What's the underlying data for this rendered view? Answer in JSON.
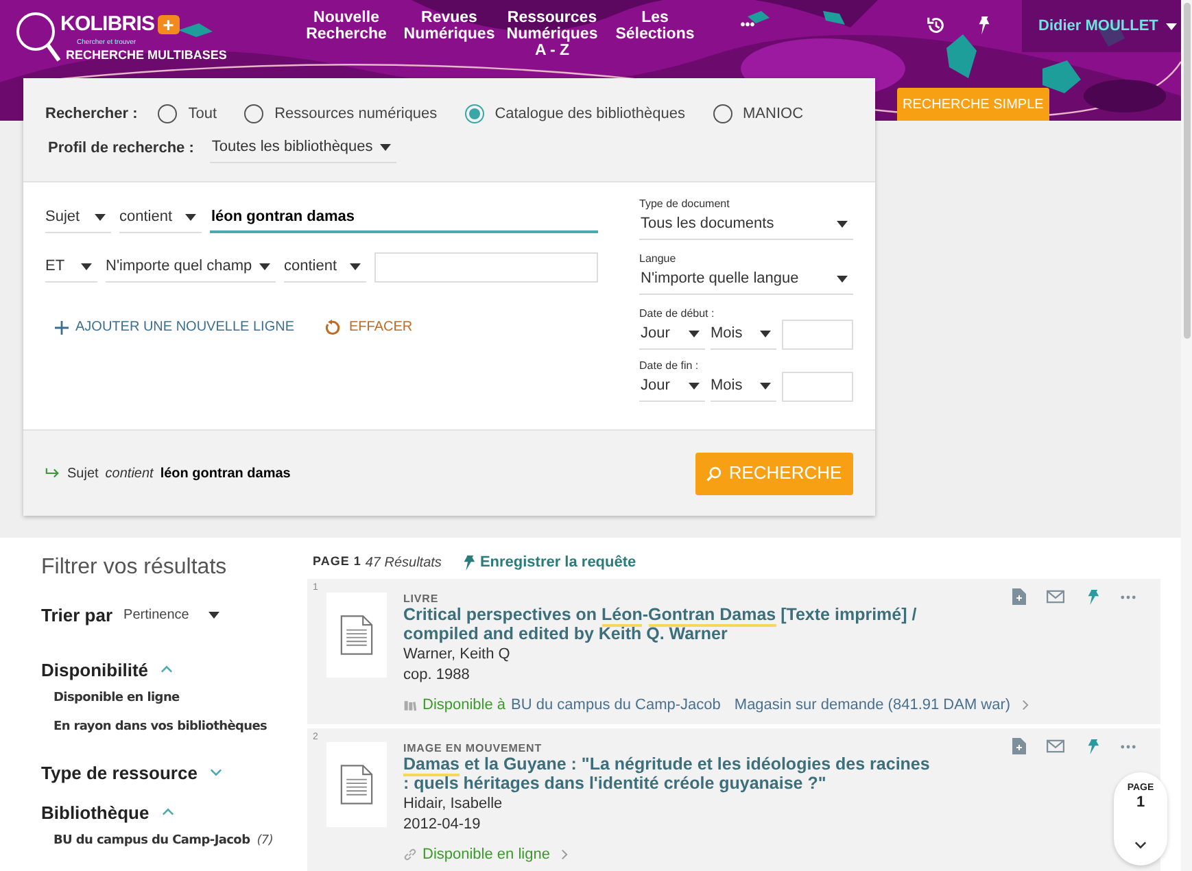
{
  "header": {
    "logo": {
      "name": "KOLIBRIS",
      "mark": "+",
      "tagline": "Chercher et trouver",
      "subtitle": "RECHERCHE MULTIBASES"
    },
    "nav": [
      {
        "label": "Nouvelle Recherche"
      },
      {
        "label": "Revues Numériques"
      },
      {
        "label": "Ressources Numériques A - Z"
      },
      {
        "label": "Les Sélections"
      }
    ],
    "more": "•••",
    "user": "Didier MOULLET"
  },
  "simple_search_button": "RECHERCHE SIMPLE",
  "search": {
    "scope_label": "Rechercher :",
    "scopes": [
      {
        "label": "Tout",
        "selected": false
      },
      {
        "label": "Ressources numériques",
        "selected": false
      },
      {
        "label": "Catalogue des bibliothèques",
        "selected": true
      },
      {
        "label": "MANIOC",
        "selected": false
      }
    ],
    "profile_label": "Profil de recherche :",
    "profile": "Toutes les bibliothèques",
    "rows": [
      {
        "field": "Sujet",
        "condition": "contient",
        "value": "léon gontran damas",
        "focused": true
      },
      {
        "operator": "ET",
        "field": "N'importe quel champ",
        "condition": "contient",
        "focused": false
      }
    ],
    "add_line": "AJOUTER UNE NOUVELLE LIGNE",
    "clear": "EFFACER",
    "filters": [
      {
        "label": "Type de document",
        "value": "Tous les documents"
      },
      {
        "label": "Langue",
        "value": "N'importe quelle langue"
      }
    ],
    "dates": [
      {
        "label": "Date de début :",
        "day": "Jour",
        "month": "Mois"
      },
      {
        "label": "Date de fin :",
        "day": "Jour",
        "month": "Mois"
      }
    ],
    "summary": {
      "field": "Sujet",
      "condition": "contient",
      "value": "léon gontran damas"
    },
    "submit": "RECHERCHE"
  },
  "filters_panel": {
    "title": "Filtrer vos résultats",
    "sort_label": "Trier par",
    "sort": "Pertinence",
    "facets": [
      {
        "title": "Disponibilité",
        "expanded": true,
        "items": [
          {
            "label": "Disponible en ligne"
          },
          {
            "label": "En rayon dans vos bibliothèques"
          }
        ]
      },
      {
        "title": "Type de ressource",
        "expanded": false
      },
      {
        "title": "Bibliothèque",
        "expanded": true,
        "items": [
          {
            "label": "BU du campus du Camp-Jacob",
            "count": "(7)"
          }
        ]
      }
    ]
  },
  "results": {
    "page": "PAGE 1",
    "count": "47 Résultats",
    "save": "Enregistrer la requête",
    "items": [
      {
        "number": "1",
        "type": "LIVRE",
        "title": [
          {
            "text": "Critical perspectives on ",
            "highlighted": false
          },
          {
            "text": "Léon",
            "highlighted": true
          },
          {
            "text": "-",
            "highlighted": false
          },
          {
            "text": "Gontran Damas",
            "highlighted": true
          },
          {
            "text": " [Texte imprimé] / compiled and edited by Keith Q. Warner",
            "highlighted": false
          }
        ],
        "author": "Warner, Keith Q",
        "date": "cop. 1988",
        "availability": {
          "kind": "location",
          "status": "Disponible à",
          "library": "BU du campus du Camp-Jacob",
          "shelf": "Magasin sur demande (841.91 DAM war)"
        }
      },
      {
        "number": "2",
        "type": "IMAGE EN MOUVEMENT",
        "title": [
          {
            "text": "Damas",
            "highlighted": true
          },
          {
            "text": " et la Guyane : \"La négritude et les idéologies des racines : quels héritages dans l'identité créole guyanaise ?\"",
            "highlighted": false
          }
        ],
        "author": "Hidair, Isabelle",
        "date": "2012-04-19",
        "availability": {
          "kind": "online",
          "status": "Disponible en ligne"
        }
      }
    ]
  },
  "pager": {
    "label": "PAGE",
    "number": "1"
  }
}
